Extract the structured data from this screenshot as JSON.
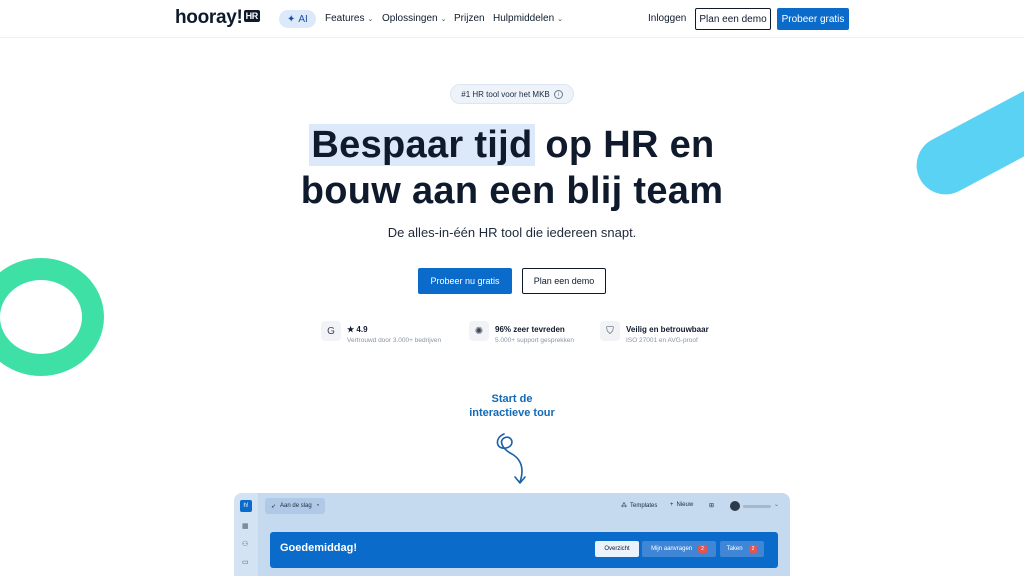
{
  "nav": {
    "logo": "hooray!",
    "logo_badge": "HR",
    "ai_label": "AI",
    "links": [
      {
        "label": "Features",
        "has_dropdown": true
      },
      {
        "label": "Oplossingen",
        "has_dropdown": true
      },
      {
        "label": "Prijzen",
        "has_dropdown": false
      },
      {
        "label": "Hulpmiddelen",
        "has_dropdown": true
      }
    ],
    "login": "Inloggen",
    "demo": "Plan een demo",
    "trial": "Probeer gratis"
  },
  "hero": {
    "badge": "#1 HR tool voor het MKB",
    "title_highlight": "Bespaar tijd",
    "title_rest": " op HR en",
    "title_line2": "bouw aan een blij team",
    "subtitle": "De alles-in-één HR tool die iedereen snapt.",
    "cta_primary": "Probeer nu gratis",
    "cta_secondary": "Plan een demo"
  },
  "trust": [
    {
      "icon": "review-icon",
      "title": "★ 4.9",
      "sub": "Vertrouwd door 3.000+ bedrijven"
    },
    {
      "icon": "party-icon",
      "title": "96% zeer tevreden",
      "sub": "5.000+ support gesprekken"
    },
    {
      "icon": "shield-icon",
      "title": "Veilig en betrouwbaar",
      "sub": "ISO 27001 en AVG-proof"
    }
  ],
  "tour": {
    "line1": "Start de",
    "line2": "interactieve tour"
  },
  "app_preview": {
    "logo": "h!",
    "onboarding": "Aan de slag",
    "templates": "Templates",
    "new": "Nieuw",
    "greeting": "Goedemiddag!",
    "tab_overview": "Overzicht",
    "tab_requests": "Mijn aanvragen",
    "requests_count": "2",
    "tab_tasks": "Taken",
    "tasks_count": "2"
  },
  "colors": {
    "brand_blue": "#0b6bcb",
    "green_ring": "#3fe0a6",
    "cyan_stripe": "#5ad2f4",
    "tour_text": "#1269b8"
  }
}
